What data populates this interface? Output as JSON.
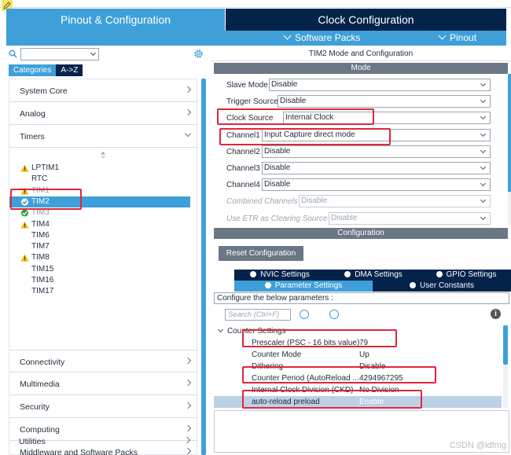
{
  "tabs": {
    "pinout": "Pinout & Configuration",
    "clock": "Clock Configuration"
  },
  "subbar": {
    "software_packs": "Software Packs",
    "pinout": "Pinout"
  },
  "left": {
    "category_tabs": [
      "Categories",
      "A->Z"
    ],
    "categories_top": [
      {
        "label": "System Core"
      },
      {
        "label": "Analog"
      },
      {
        "label": "Timers"
      }
    ],
    "peripherals": [
      {
        "label": "LPTIM1",
        "icon": "warning-icon"
      },
      {
        "label": "RTC",
        "icon": ""
      },
      {
        "label": "TIM1",
        "icon": "warning-icon"
      },
      {
        "label": "TIM2",
        "icon": "check-icon"
      },
      {
        "label": "TIM3",
        "icon": "check-icon"
      },
      {
        "label": "TIM4",
        "icon": "warning-icon"
      },
      {
        "label": "TIM6",
        "icon": ""
      },
      {
        "label": "TIM7",
        "icon": ""
      },
      {
        "label": "TIM8",
        "icon": "warning-icon"
      },
      {
        "label": "TIM15",
        "icon": ""
      },
      {
        "label": "TIM16",
        "icon": ""
      },
      {
        "label": "TIM17",
        "icon": ""
      }
    ],
    "selected_peripheral": "TIM2",
    "categories_bottom": [
      {
        "label": "Connectivity"
      },
      {
        "label": "Multimedia"
      },
      {
        "label": "Security"
      },
      {
        "label": "Computing"
      },
      {
        "label": "Middleware and Software Packs"
      },
      {
        "label": "Utilities"
      }
    ]
  },
  "right": {
    "title": "TIM2 Mode and Configuration",
    "mode_header": "Mode",
    "config_header": "Configuration",
    "mode_rows": [
      {
        "label": "Slave Mode",
        "value": "Disable",
        "enabled": true
      },
      {
        "label": "Trigger Source",
        "value": "Disable",
        "enabled": true
      },
      {
        "label": "Clock Source",
        "value": "Internal Clock",
        "enabled": true
      },
      {
        "label": "Channel1",
        "value": "Input Capture direct mode",
        "enabled": true
      },
      {
        "label": "Channel2",
        "value": "Disable",
        "enabled": true
      },
      {
        "label": "Channel3",
        "value": "Disable",
        "enabled": true
      },
      {
        "label": "Channel4",
        "value": "Disable",
        "enabled": true
      },
      {
        "label": "Combined Channels",
        "value": "Disable",
        "enabled": false
      },
      {
        "label": "Use ETR as Clearing Source",
        "value": "Disable",
        "enabled": false
      }
    ],
    "reset_button": "Reset Configuration",
    "settings_tabs_row1": [
      "NVIC Settings",
      "DMA Settings",
      "GPIO Settings"
    ],
    "settings_tabs_row2": [
      "Parameter Settings",
      "User Constants"
    ],
    "active_settings_tab": "Parameter Settings",
    "config_message": "Configure the below parameters :",
    "search_placeholder": "Search (Ctrl+F)",
    "group_label": "Counter Settings",
    "params": [
      {
        "label": "Prescaler (PSC - 16 bits value)",
        "value": "79"
      },
      {
        "label": "Counter Mode",
        "value": "Up"
      },
      {
        "label": "Dithering",
        "value": "Disable"
      },
      {
        "label": "Counter Period (AutoReload ...",
        "value": "4294967295"
      },
      {
        "label": "Internal Clock Division (CKD)",
        "value": "No Division"
      },
      {
        "label": "auto-reload preload",
        "value": "Enable"
      }
    ],
    "highlighted_param": "auto-reload preload"
  },
  "watermark": "CSDN @ldfmg",
  "colors": {
    "accent_blue": "#3fa0d9",
    "navy": "#03234b",
    "annotation_red": "#e0263a",
    "warning_yellow": "#f2b705",
    "check_green": "#2e9e3f"
  }
}
